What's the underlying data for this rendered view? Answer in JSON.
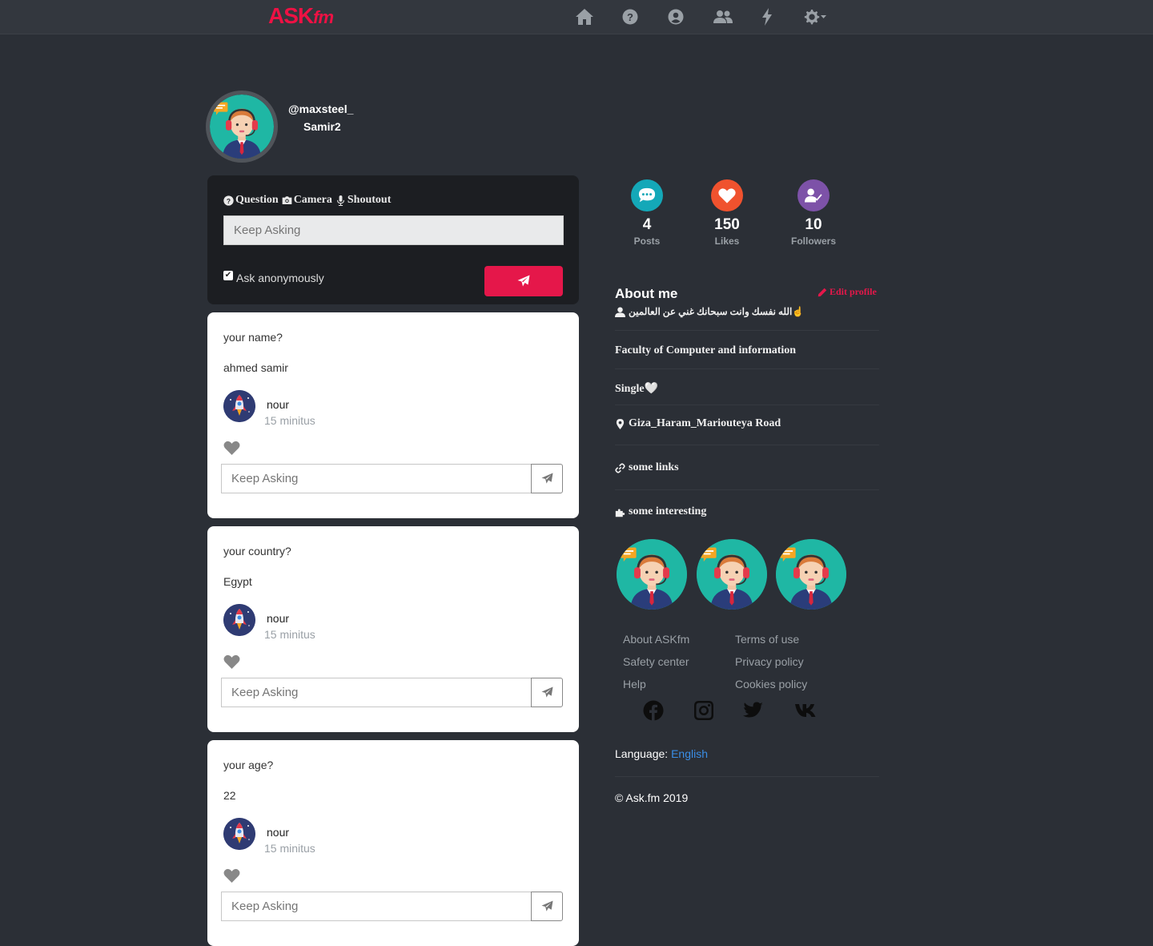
{
  "brand": {
    "logo_main": "ASK",
    "logo_suffix": "fm",
    "color": "#ee1144"
  },
  "nav": {
    "icons": [
      "home-icon",
      "question-circle-icon",
      "user-circle-icon",
      "users-icon",
      "bolt-icon",
      "gear-dropdown-icon"
    ]
  },
  "profile": {
    "username": "@maxsteel_",
    "display_name": "Samir2"
  },
  "ask_box": {
    "tabs": [
      {
        "label": "Question",
        "icon": "question-circle-icon"
      },
      {
        "label": "Camera",
        "icon": "camera-icon"
      },
      {
        "label": "Shoutout",
        "icon": "microphone-icon"
      }
    ],
    "input_placeholder": "Keep Asking",
    "anonymous_label": "Ask anonymously",
    "anonymous_checked": true,
    "send_color": "#e5174a"
  },
  "posts": [
    {
      "question": "your name?",
      "answer": "ahmed samir",
      "user": "nour",
      "time": "15 minitus",
      "reply_placeholder": "Keep Asking"
    },
    {
      "question": "your country?",
      "answer": "Egypt",
      "user": "nour",
      "time": "15 minitus",
      "reply_placeholder": "Keep Asking"
    },
    {
      "question": "your age?",
      "answer": "22",
      "user": "nour",
      "time": "15 minitus",
      "reply_placeholder": "Keep Asking"
    }
  ],
  "stats": [
    {
      "value": "4",
      "label": "Posts",
      "color": "#14a8b8",
      "icon": "comment-dots-icon"
    },
    {
      "value": "150",
      "label": "Likes",
      "color": "#f0522e",
      "icon": "heart-icon"
    },
    {
      "value": "10",
      "label": "Followers",
      "color": "#7d52a8",
      "icon": "user-check-icon"
    }
  ],
  "about": {
    "title": "About me",
    "edit_label": "Edit profile",
    "bio": "الله نفسك وانت سبحانك غني عن العالمين☝",
    "faculty": "Faculty of Computer and information",
    "status": "Single🤍",
    "location": "Giza_Haram_Mariouteya Road",
    "links": "some links",
    "interesting": "some interesting"
  },
  "footer": {
    "links_left": [
      "About ASKfm",
      "Safety center",
      "Help"
    ],
    "links_right": [
      "Terms of use",
      "Privacy policy",
      "Cookies policy"
    ],
    "social_icons": [
      "facebook-icon",
      "instagram-icon",
      "twitter-icon",
      "vk-icon"
    ],
    "language_label": "Language:",
    "language_value": "English",
    "copyright": "© Ask.fm 2019"
  }
}
